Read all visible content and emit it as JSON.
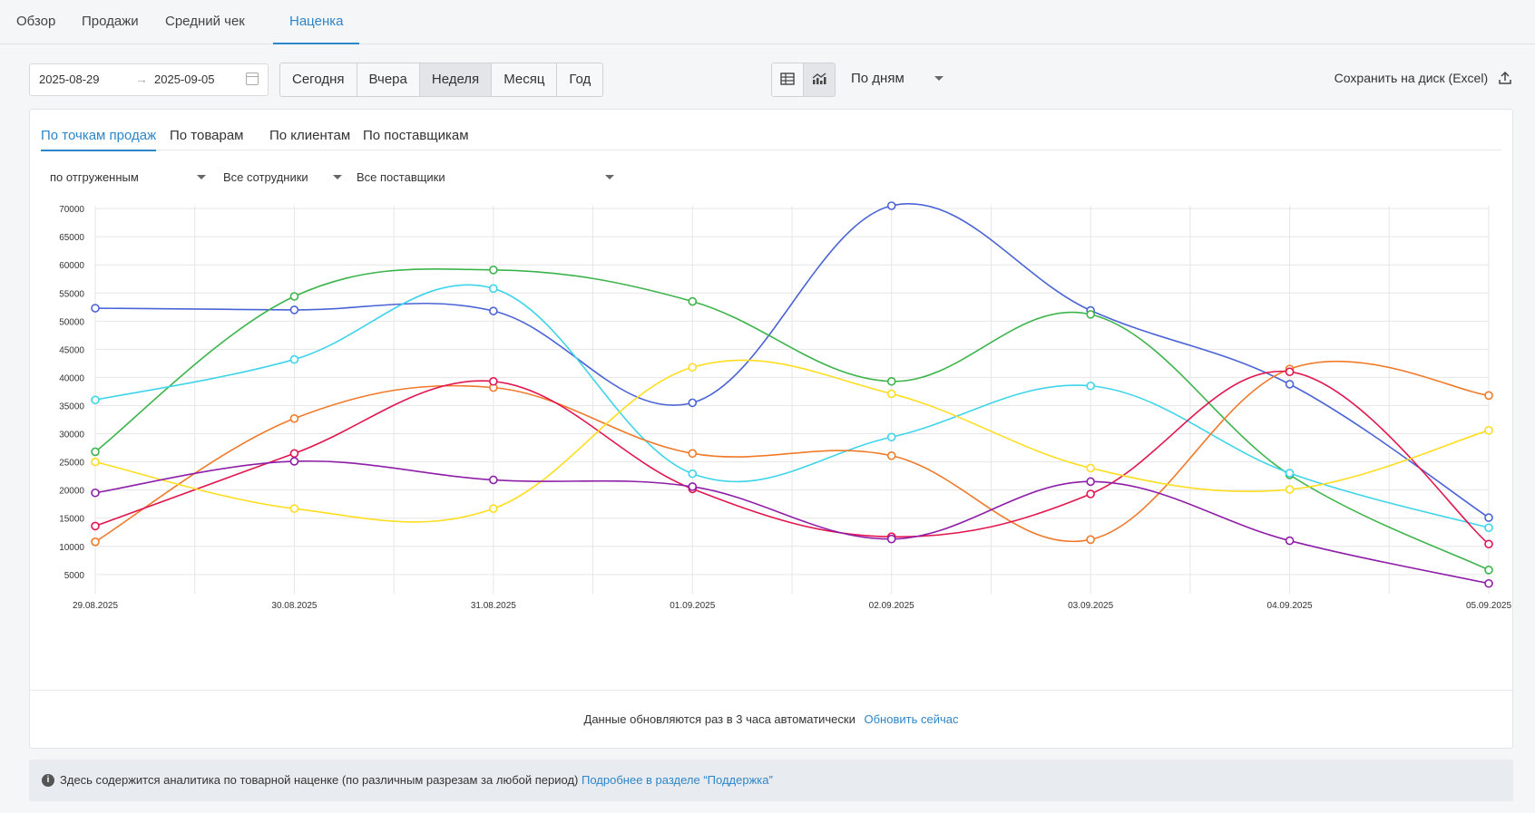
{
  "top_tabs": [
    "Обзор",
    "Продажи",
    "Средний чек",
    "Наценка"
  ],
  "date_from": "2025-08-29",
  "date_to": "2025-09-05",
  "period_buttons": [
    "Сегодня",
    "Вчера",
    "Неделя",
    "Месяц",
    "Год"
  ],
  "active_period": "Неделя",
  "group_by": "По дням",
  "save_label": "Сохранить на диск (Excel)",
  "sub_tabs": [
    "По точкам продаж",
    "По товарам",
    "По клиентам",
    "По поставщикам"
  ],
  "filters": {
    "shipment": "по отгруженным",
    "employees": "Все сотрудники",
    "suppliers": "Все поставщики"
  },
  "footer": {
    "note": "Данные обновляются раз в 3 часа автоматически",
    "refresh_link": "Обновить сейчас"
  },
  "info": {
    "icon": "info-icon",
    "text": "Здесь содержится аналитика по товарной наценке (по различным разрезам за любой период)",
    "link": "Подробнее в разделе “Поддержка”"
  },
  "chart_data": {
    "type": "line",
    "x": [
      "29.08.2025",
      "30.08.2025",
      "31.08.2025",
      "01.09.2025",
      "02.09.2025",
      "03.09.2025",
      "04.09.2025",
      "05.09.2025"
    ],
    "y_ticks": [
      5000,
      10000,
      15000,
      20000,
      25000,
      30000,
      35000,
      40000,
      45000,
      50000,
      55000,
      60000,
      65000,
      70000
    ],
    "ylim": [
      3200,
      70500
    ],
    "grid": true,
    "series": [
      {
        "color": "#4a64d6",
        "values": [
          52300,
          52000,
          51800,
          35500,
          70500,
          51900,
          38800,
          15100
        ]
      },
      {
        "color": "#3cb44b",
        "values": [
          26800,
          54400,
          59100,
          53500,
          39300,
          51200,
          22700,
          5800
        ]
      },
      {
        "color": "#3fd4ea",
        "values": [
          36000,
          43200,
          55800,
          22900,
          29400,
          38500,
          23000,
          13300
        ]
      },
      {
        "color": "#f07a2a",
        "values": [
          10800,
          32700,
          38200,
          26500,
          26100,
          11200,
          41500,
          36800
        ]
      },
      {
        "color": "#e2164e",
        "values": [
          13600,
          26500,
          39300,
          20200,
          11700,
          19300,
          41000,
          10400
        ]
      },
      {
        "color": "#ffdd1f",
        "values": [
          25000,
          16700,
          16700,
          41800,
          37100,
          23900,
          20100,
          30600
        ]
      },
      {
        "color": "#8e1ea8",
        "values": [
          19500,
          25100,
          21800,
          20600,
          11300,
          21500,
          11000,
          3400
        ]
      }
    ]
  }
}
